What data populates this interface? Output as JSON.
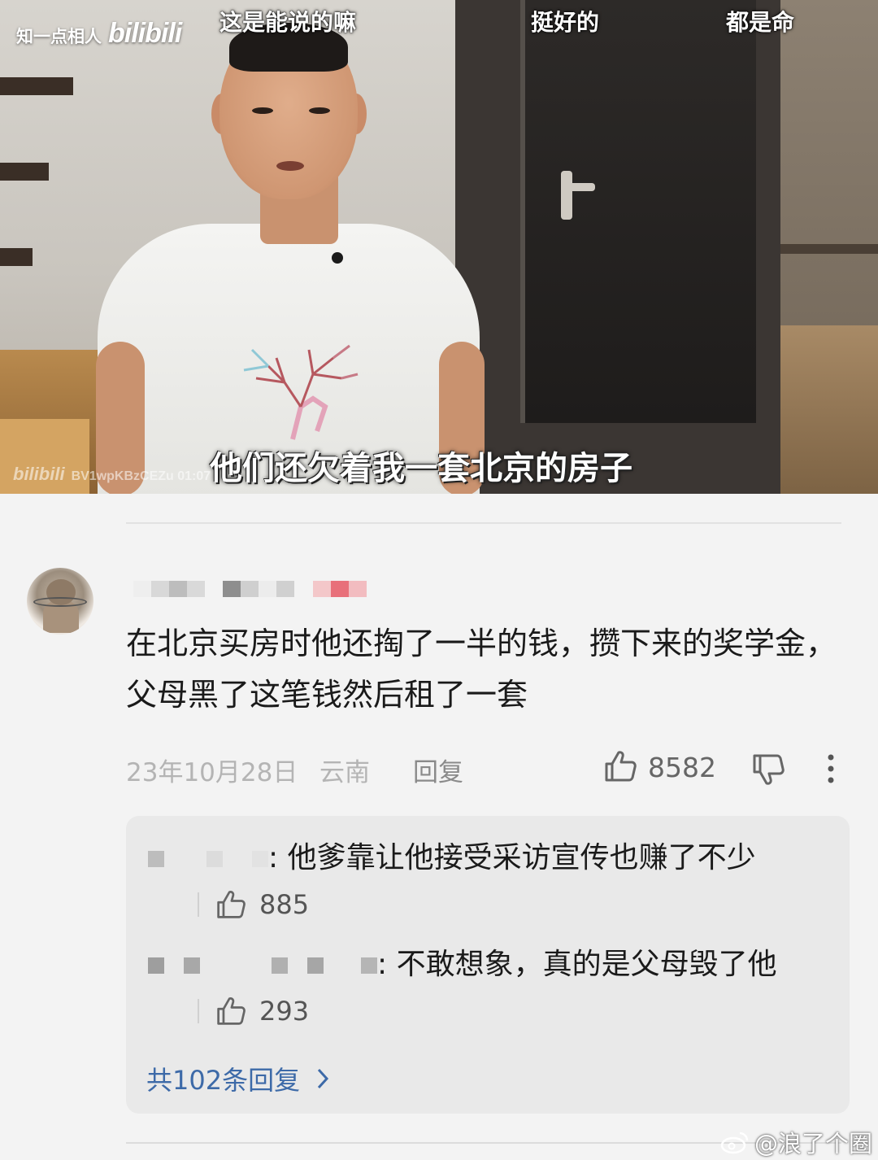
{
  "video": {
    "channel_label": "知一点相人",
    "platform_logo": "bilibili",
    "top_captions": [
      "这是能说的嘛",
      "挺好的",
      "都是命"
    ],
    "subtitle": "他们还欠着我一套北京的房子",
    "bottom_watermark_logo": "bilibili",
    "bottom_watermark_code": "BV1wpKBzCEZu 01:07"
  },
  "comment": {
    "text": "在北京买房时他还掏了一半的钱，攒下来的奖学金，父母黑了这笔钱然后租了一套",
    "date": "23年10月28日",
    "location": "云南",
    "reply_label": "回复",
    "like_count": "8582",
    "icons": {
      "like": "thumbs-up-icon",
      "dislike": "thumbs-down-icon",
      "more": "more-vertical-icon"
    }
  },
  "replies": [
    {
      "text": "他爹靠让他接受采访宣传也赚了不少",
      "like_count": "885"
    },
    {
      "text": "不敢想象，真的是父母毁了他",
      "like_count": "293"
    }
  ],
  "total_replies_label": "共102条回复",
  "footer_watermark": "@浪了个圈",
  "colors": {
    "link": "#3d6aa8",
    "meta": "#b4b4b4",
    "background": "#f3f3f3",
    "reply_bg": "#e9e9e9"
  }
}
